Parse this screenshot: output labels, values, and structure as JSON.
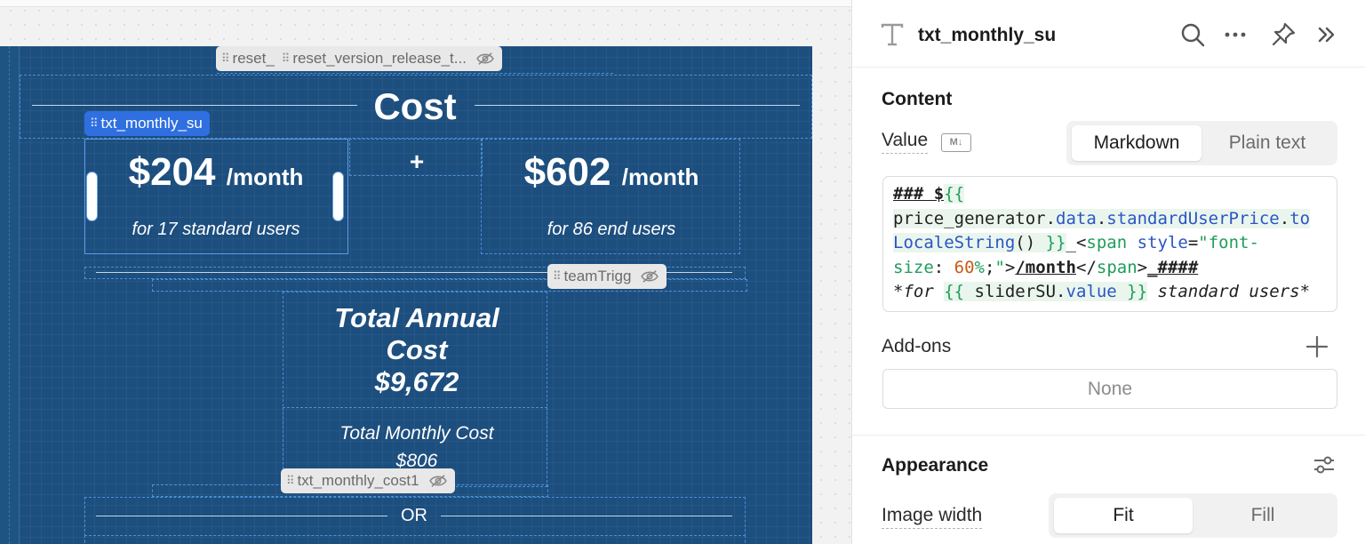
{
  "canvas": {
    "cost_title": "Cost",
    "plus_sign": "+",
    "standard": {
      "price": "$204",
      "unit": "/month",
      "caption": "for 17 standard users"
    },
    "end": {
      "price": "$602",
      "unit": "/month",
      "caption": "for 86 end users"
    },
    "annual_line1": "Total Annual",
    "annual_line2": "Cost",
    "annual_value": "$9,672",
    "monthly_label": "Total Monthly Cost",
    "monthly_value": "$806",
    "or_text": "OR",
    "labels": {
      "selected": "txt_monthly_su",
      "reset_a": "reset_",
      "reset_b": "reset_version_release_t...",
      "team_trigg": "teamTrigg",
      "monthly_cost": "txt_monthly_cost1"
    },
    "colors": {
      "container_bg": "#1c4e7e",
      "selection_accent": "#2f6fe0"
    }
  },
  "panel": {
    "title": "txt_monthly_su",
    "content_heading": "Content",
    "value_label": "Value",
    "markdown_badge": "M↓",
    "modes": [
      "Markdown",
      "Plain text"
    ],
    "active_mode": "Markdown",
    "code": {
      "l1_prefix": "### $",
      "l1_open": "{{",
      "l2_obj": "price_generator",
      "l2_dot1": ".",
      "l2_data": "data",
      "l2_dot2": ".",
      "l2_prop": "standardUserPrice",
      "l2_dot3": ".",
      "l2_fn": "to",
      "l3_fn": "LocaleString",
      "l3_paren": "() ",
      "l3_close": "}}",
      "l3_us": "_",
      "l3_lt": "<",
      "l3_tag": "span",
      "l3_sp": " ",
      "l3_attr": "style",
      "l3_eq": "=",
      "l3_str": "\"font-",
      "l4_str": "size",
      "l4_colon": ": ",
      "l4_num": "60",
      "l4_pct": "%",
      "l4_semi": ";",
      "l4_q": "\"",
      "l4_gt": ">",
      "l4_month": "/month",
      "l4_lt": "</",
      "l4_tag": "span",
      "l4_gt2": ">",
      "l4_hashes": "_####",
      "l5_for": "*for ",
      "l5_open": "{{",
      "l5_var": " sliderSU",
      "l5_dot": ".",
      "l5_val": "value",
      "l5_close": " }}",
      "l5_rest": " standard users*"
    },
    "addons_label": "Add-ons",
    "addons_value": "None",
    "appearance_label": "Appearance",
    "image_width_label": "Image width",
    "width_modes": [
      "Fit",
      "Fill"
    ],
    "active_width_mode": "Fit"
  }
}
